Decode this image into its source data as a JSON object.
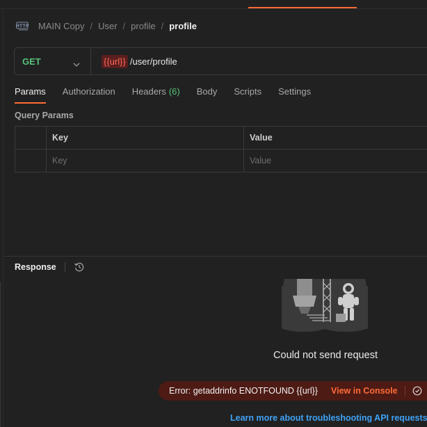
{
  "breadcrumb": {
    "icon": "http-request-icon",
    "items": [
      "MAIN Copy",
      "User",
      "profile"
    ],
    "current": "profile",
    "separator": "/"
  },
  "request": {
    "method": "GET",
    "url_variable": "{{url}}",
    "url_path": "/user/profile"
  },
  "tabs": [
    {
      "label": "Params",
      "active": true
    },
    {
      "label": "Authorization",
      "active": false
    },
    {
      "label": "Headers",
      "count": "(6)",
      "active": false
    },
    {
      "label": "Body",
      "active": false
    },
    {
      "label": "Scripts",
      "active": false
    },
    {
      "label": "Settings",
      "active": false
    }
  ],
  "query_params": {
    "title": "Query Params",
    "columns": [
      "Key",
      "Value"
    ],
    "placeholder_key": "Key",
    "placeholder_value": "Value"
  },
  "response": {
    "title": "Response",
    "error_title": "Could not send request",
    "error_message": "Error: getaddrinfo ENOTFOUND {{url}}",
    "view_console": "View in Console",
    "learn_more": "Learn more about troubleshooting API requests"
  },
  "colors": {
    "accent": "#ff6c37",
    "method_get": "#57c27b",
    "variable_error": "#ff6b5c",
    "link": "#3ea2f5"
  }
}
